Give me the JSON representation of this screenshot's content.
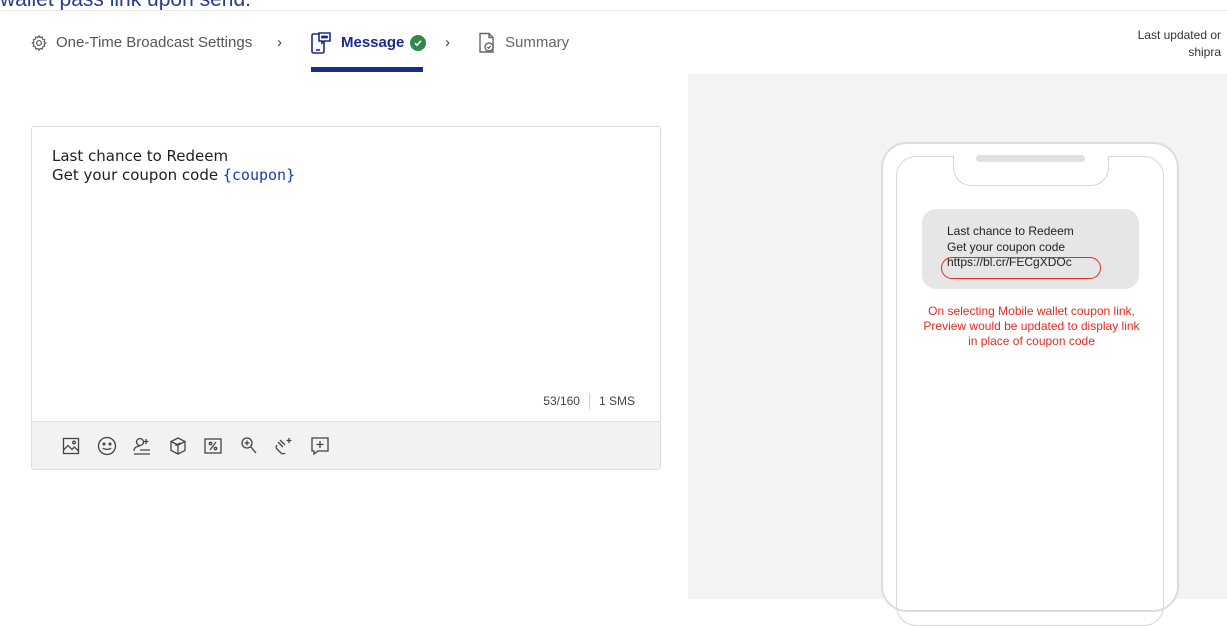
{
  "page_title_fragment": "wallet pass link upon send.",
  "steps": [
    {
      "label": "One-Time Broadcast Settings",
      "icon": "gear-icon"
    },
    {
      "label": "Message",
      "icon": "mobile-message-icon",
      "status": "check-icon"
    },
    {
      "label": "Summary",
      "icon": "document-check-icon"
    }
  ],
  "step_separator": "›",
  "last_updated": {
    "line1": "Last updated or",
    "line2": "shipra"
  },
  "editor": {
    "line1": "Last chance to Redeem",
    "line2_prefix": "Get your coupon code ",
    "line2_tag": "{coupon}",
    "char_count": "53/160",
    "sms_count": "1 SMS",
    "toolbar_icons": [
      "image-icon",
      "emoji-icon",
      "personalize-user-icon",
      "offer-box-icon",
      "discount-tag-icon",
      "search-link-icon",
      "coupon-link-icon",
      "add-text-icon"
    ]
  },
  "preview": {
    "line1": "Last chance to Redeem",
    "line2": "Get your coupon code",
    "link": "https://bl.cr/FECgXDOc",
    "annotation": "On selecting Mobile wallet coupon link, Preview would be updated to display link in place of coupon code",
    "annotation_color": "#e52a1e"
  },
  "colors": {
    "accent": "#1c2a8c",
    "success": "#2e8a4c",
    "tag": "#1a3bb8"
  }
}
